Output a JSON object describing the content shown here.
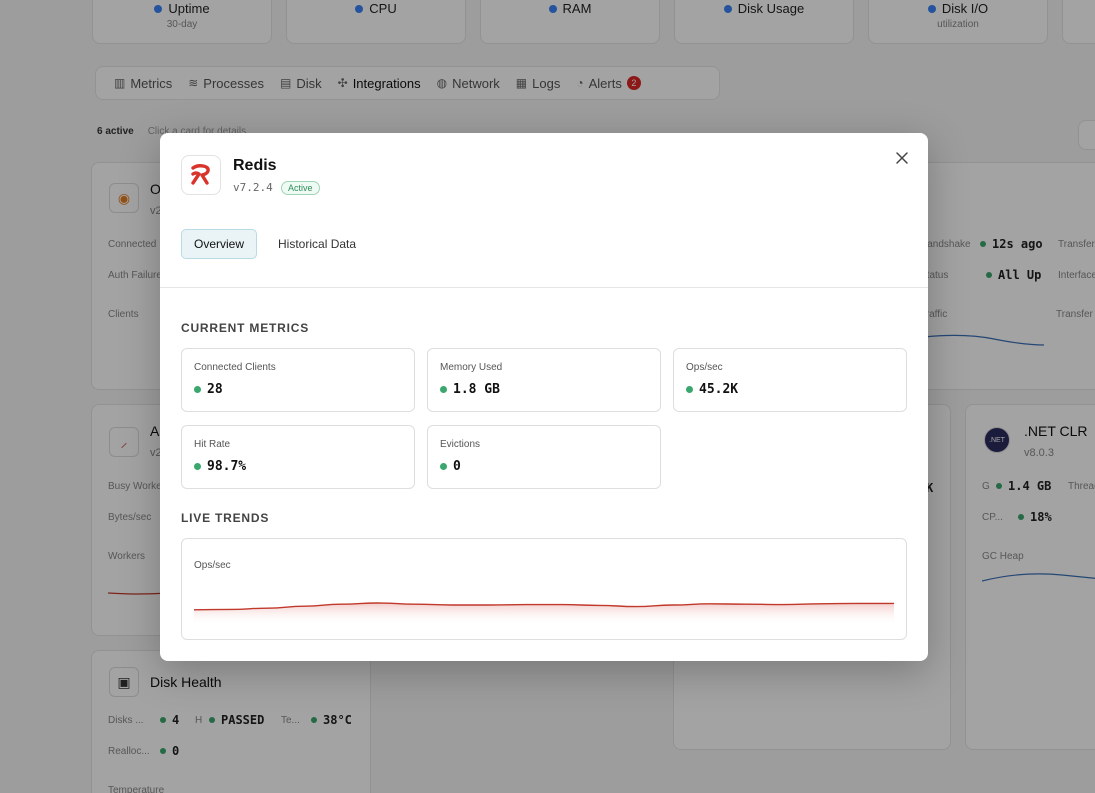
{
  "stats": [
    {
      "label": "Uptime",
      "sub": "30-day"
    },
    {
      "label": "CPU",
      "sub": ""
    },
    {
      "label": "RAM",
      "sub": ""
    },
    {
      "label": "Disk Usage",
      "sub": ""
    },
    {
      "label": "Disk I/O",
      "sub": "utilization"
    }
  ],
  "tabs": [
    {
      "label": "Metrics",
      "icon": "bar-chart-icon"
    },
    {
      "label": "Processes",
      "icon": "layers-icon"
    },
    {
      "label": "Disk",
      "icon": "database-icon"
    },
    {
      "label": "Integrations",
      "icon": "puzzle-icon"
    },
    {
      "label": "Network",
      "icon": "globe-icon"
    },
    {
      "label": "Logs",
      "icon": "log-icon"
    },
    {
      "label": "Alerts",
      "icon": "bell-icon",
      "badge": "2"
    }
  ],
  "active_tab": "Integrations",
  "integrations_summary": {
    "count": "6 active",
    "hint": "Click a card for details"
  },
  "bg_cards": {
    "openvpn": {
      "name": "O",
      "ver": "v2",
      "l1": "Connected",
      "l2": "Auth Failures",
      "chart_label": "Clients"
    },
    "apache": {
      "name": "A",
      "ver": "v2",
      "l1": "Busy Workers",
      "l2": "Bytes/sec",
      "chart_label": "Workers"
    },
    "wireguard": {
      "l1": "Handshake",
      "v1": "12s ago",
      "l1b": "Transfer",
      "l2": "Status",
      "v2": "All Up",
      "l2b": "Interfaces",
      "chart_label": "Traffic",
      "chart_label_b": "Transfer"
    },
    "dotnet": {
      "name": ".NET CLR",
      "ver": "v8.0.3",
      "l1": "G",
      "v1": "1.4 GB",
      "l1b": "Threads",
      "l2": "CP...",
      "v2": "18%",
      "chart_label": "GC Heap",
      "partial_val": "K"
    },
    "disk": {
      "name": "Disk Health",
      "l1": "Disks ...",
      "v1": "4",
      "l1b": "H",
      "v1b": "PASSED",
      "l1c": "Te...",
      "v1c": "38°C",
      "l2": "Realloc...",
      "v2": "0",
      "chart_label": "Temperature"
    }
  },
  "modal": {
    "title": "Redis",
    "version": "v7.2.4",
    "status": "Active",
    "tabs": [
      "Overview",
      "Historical Data"
    ],
    "active_tab": "Overview",
    "current_metrics_title": "CURRENT METRICS",
    "metrics": [
      {
        "label": "Connected Clients",
        "value": "28"
      },
      {
        "label": "Memory Used",
        "value": "1.8 GB"
      },
      {
        "label": "Ops/sec",
        "value": "45.2K"
      },
      {
        "label": "Hit Rate",
        "value": "98.7%"
      },
      {
        "label": "Evictions",
        "value": "0"
      }
    ],
    "live_trends_title": "LIVE TRENDS",
    "trend_label": "Ops/sec"
  },
  "colors": {
    "status_green": "#3aa76d",
    "trend_red": "#c0392b",
    "accent_blue": "#3b82f6",
    "alert_red": "#dc2626"
  },
  "chart_data": {
    "type": "area",
    "series": [
      {
        "name": "Ops/sec",
        "values": [
          0.38,
          0.39,
          0.42,
          0.47,
          0.52,
          0.55,
          0.52,
          0.5,
          0.5,
          0.51,
          0.51,
          0.49,
          0.46,
          0.5,
          0.53,
          0.52,
          0.51,
          0.53,
          0.54,
          0.54
        ]
      }
    ]
  }
}
